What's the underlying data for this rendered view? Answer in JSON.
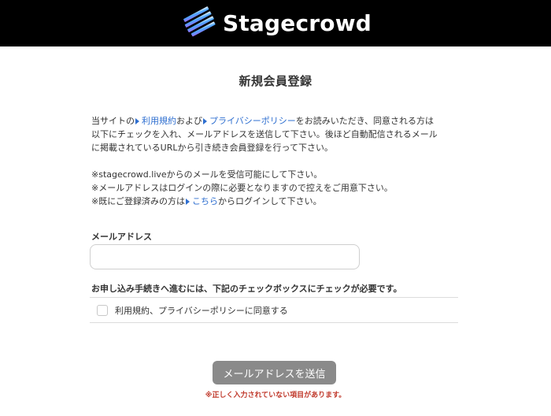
{
  "header": {
    "brand_name": "Stagecrowd",
    "logo_icon": "stagecrowd-stripes-logo",
    "colors": {
      "background": "#000000",
      "brand_gradient": [
        "#9b6cff",
        "#49a6ff",
        "#ffffff"
      ]
    }
  },
  "page": {
    "title": "新規会員登録"
  },
  "intro": {
    "line1_prefix": "当サイトの",
    "terms_link": "利用規約",
    "line1_mid": "および",
    "privacy_link": "プライバシーポリシー",
    "line1_suffix": "をお読みいただき、同意される方は",
    "line2": "以下にチェックを入れ、メールアドレスを送信して下さい。後ほど自動配信されるメール",
    "line3": "に掲載されているURLから引き続き会員登録を行って下さい。",
    "note1": "※stagecrowd.liveからのメールを受信可能にして下さい。",
    "note2": "※メールアドレスはログインの際に必要となりますので控えをご用意下さい。",
    "note3_prefix": "※既にご登録済みの方は",
    "login_link": "こちら",
    "note3_suffix": "からログインして下さい。",
    "link_color": "#2f6fd0"
  },
  "form": {
    "email_label": "メールアドレス",
    "email_value": "",
    "email_placeholder": "",
    "consent_requirement": "お申し込み手続きへ進むには、下記のチェックボックスにチェックが必要です。",
    "consent_checkbox_label": "利用規約、プライバシーポリシーに同意する",
    "consent_checked": false,
    "submit_label": "メールアドレスを送信",
    "error_message": "※正しく入力されていない項目があります。",
    "error_color": "#c0392b"
  }
}
